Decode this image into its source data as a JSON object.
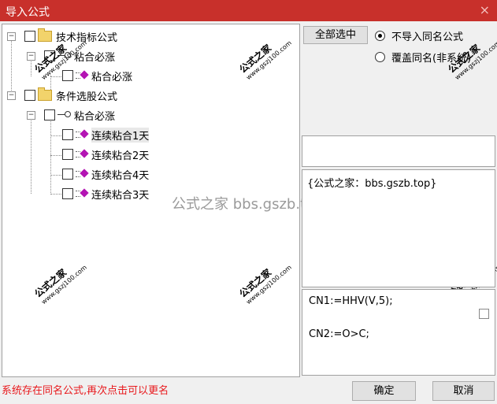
{
  "window": {
    "title": "导入公式",
    "close_glyph": "×"
  },
  "tree": {
    "root1": {
      "label": "技术指标公式",
      "expander": "−"
    },
    "root1_child": {
      "label": "粘合必涨",
      "expander": "−"
    },
    "root1_leaf": {
      "label": "粘合必涨"
    },
    "root2": {
      "label": "条件选股公式",
      "expander": "−"
    },
    "root2_child": {
      "label": "粘合必涨",
      "expander": "−"
    },
    "leaves": [
      {
        "label": "连续粘合1天"
      },
      {
        "label": "连续粘合2天"
      },
      {
        "label": "连续粘合4天"
      },
      {
        "label": "连续粘合3天"
      }
    ]
  },
  "controls": {
    "select_all": "全部选中",
    "radio_skip": "不导入同名公式",
    "radio_overwrite": "覆盖同名(非系统)"
  },
  "description": "{公式之家：bbs.gszb.top}",
  "code_lines": [
    "CN1:=HHV(V,5);",
    "CN2:=O>C;"
  ],
  "status": "系统存在同名公式,再次点击可以更名",
  "buttons": {
    "ok": "确定",
    "cancel": "取消"
  },
  "watermark": {
    "brand": "公式之家",
    "site": "www.gszj100.com",
    "center": "公式之家 bbs.gszb.top"
  },
  "colors": {
    "titlebar": "#c8302b",
    "status_text": "#e8181c",
    "formula_icon": "#b314b3"
  }
}
